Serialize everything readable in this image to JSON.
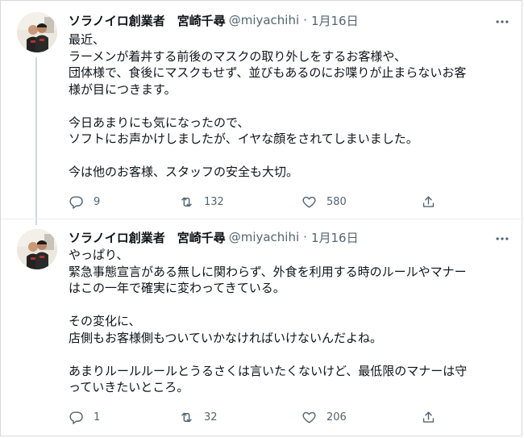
{
  "tweets": [
    {
      "display_name": "ソラノイロ創業者　宮崎千尋",
      "handle": "@miyachihi",
      "separator": "·",
      "date": "1月16日",
      "lines": [
        "最近、",
        "ラーメンが着丼する前後のマスクの取り外しをするお客様や、",
        "団体様で、食後にマスクもせず、並びもあるのにお喋りが止まらないお客",
        "様が目につきます。",
        "",
        "今日あまりにも気になったので、",
        "ソフトにお声かけしましたが、イヤな顔をされてしまいました。",
        "",
        "今は他のお客様、スタッフの安全も大切。"
      ],
      "reply_count": "9",
      "retweet_count": "132",
      "like_count": "580",
      "icons": {
        "reply": "reply-icon",
        "retweet": "retweet-icon",
        "like": "heart-icon",
        "share": "share-icon",
        "more": "more-icon"
      }
    },
    {
      "display_name": "ソラノイロ創業者　宮崎千尋",
      "handle": "@miyachihi",
      "separator": "·",
      "date": "1月16日",
      "lines": [
        "やっぱり、",
        "緊急事態宣言がある無しに関わらず、外食を利用する時のルールやマナー",
        "はこの一年で確実に変わってきている。",
        "",
        "その変化に、",
        "店側もお客様側もついていかなければいけないんだよね。",
        "",
        "あまりルールルールとうるさくは言いたくないけど、最低限のマナーは守",
        "っていきたいところ。"
      ],
      "reply_count": "1",
      "retweet_count": "32",
      "like_count": "206",
      "icons": {
        "reply": "reply-icon",
        "retweet": "retweet-icon",
        "like": "heart-icon",
        "share": "share-icon",
        "more": "more-icon"
      }
    }
  ],
  "colors": {
    "text": "#0f1419",
    "secondary": "#536471",
    "thread_line": "#cfd9de",
    "divider": "#e6ecf0"
  }
}
